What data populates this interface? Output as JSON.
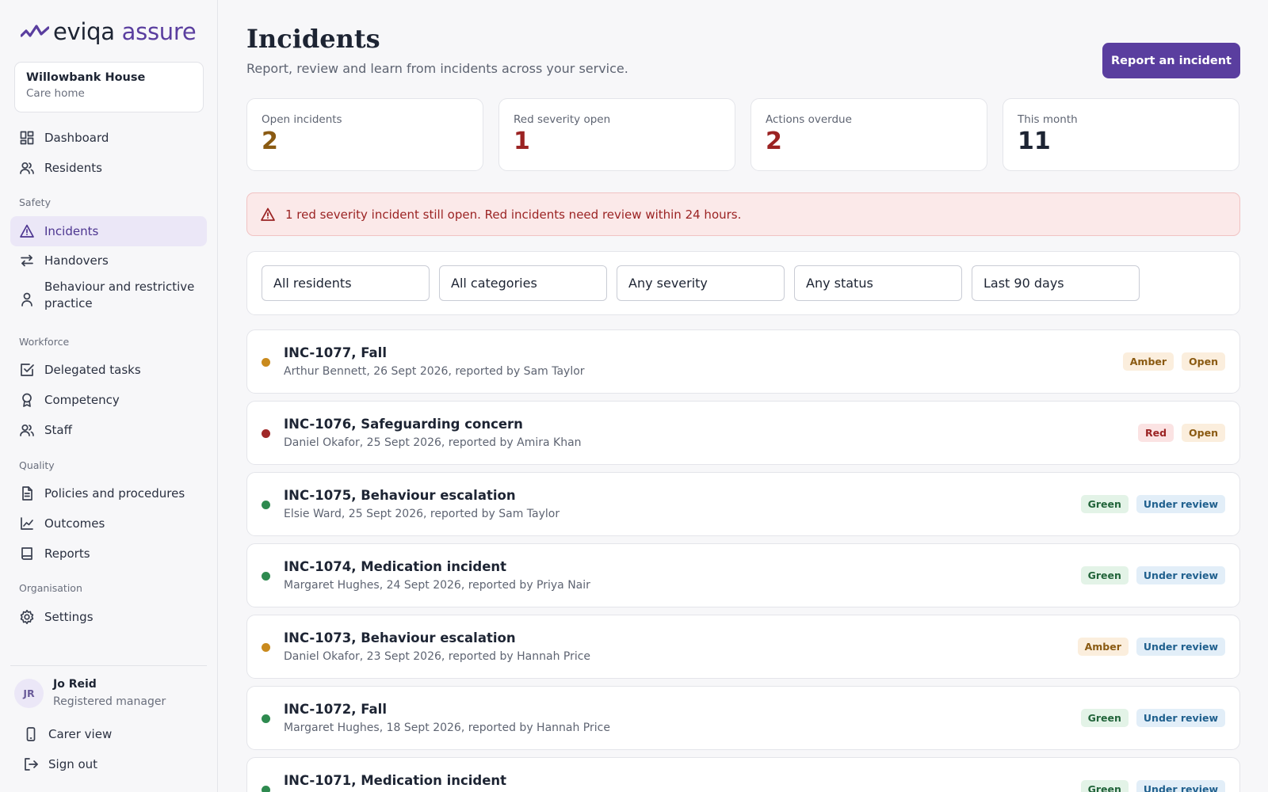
{
  "brand": {
    "name_part1": "eviqa",
    "name_part2": "assure"
  },
  "organisation": {
    "name": "Willowbank House",
    "type": "Care home"
  },
  "nav": {
    "dashboard": "Dashboard",
    "residents": "Residents",
    "section_safety": "Safety",
    "incidents": "Incidents",
    "handovers": "Handovers",
    "behaviour": "Behaviour and restrictive practice",
    "section_workforce": "Workforce",
    "delegated_tasks": "Delegated tasks",
    "competency": "Competency",
    "staff": "Staff",
    "section_quality": "Quality",
    "policies": "Policies and procedures",
    "outcomes": "Outcomes",
    "reports": "Reports",
    "section_organisation": "Organisation",
    "settings": "Settings"
  },
  "user": {
    "initials": "JR",
    "name": "Jo Reid",
    "role": "Registered manager",
    "carer_view": "Carer view",
    "sign_out": "Sign out"
  },
  "page": {
    "title": "Incidents",
    "subtitle": "Report, review and learn from incidents across your service.",
    "report_button": "Report an incident"
  },
  "stats": [
    {
      "label": "Open incidents",
      "value": "2",
      "color": "#8a5a12"
    },
    {
      "label": "Red severity open",
      "value": "1",
      "color": "#9b2323"
    },
    {
      "label": "Actions overdue",
      "value": "2",
      "color": "#9b2323"
    },
    {
      "label": "This month",
      "value": "11",
      "color": "#1d2433"
    }
  ],
  "alert": {
    "text": "1 red severity incident still open. Red incidents need review within 24 hours."
  },
  "filters": [
    "All residents",
    "All categories",
    "Any severity",
    "Any status",
    "Last 90 days"
  ],
  "colors": {
    "accent": "#5a3e9f",
    "amber": "#c98a1d",
    "red": "#a02828",
    "green": "#2e8a4f"
  },
  "incidents": [
    {
      "title": "INC-1077, Fall",
      "meta": "Arthur Bennett, 26 Sept 2026, reported by Sam Taylor",
      "severity": "Amber",
      "status": "Open"
    },
    {
      "title": "INC-1076, Safeguarding concern",
      "meta": "Daniel Okafor, 25 Sept 2026, reported by Amira Khan",
      "severity": "Red",
      "status": "Open"
    },
    {
      "title": "INC-1075, Behaviour escalation",
      "meta": "Elsie Ward, 25 Sept 2026, reported by Sam Taylor",
      "severity": "Green",
      "status": "Under review"
    },
    {
      "title": "INC-1074, Medication incident",
      "meta": "Margaret Hughes, 24 Sept 2026, reported by Priya Nair",
      "severity": "Green",
      "status": "Under review"
    },
    {
      "title": "INC-1073, Behaviour escalation",
      "meta": "Daniel Okafor, 23 Sept 2026, reported by Hannah Price",
      "severity": "Amber",
      "status": "Under review"
    },
    {
      "title": "INC-1072, Fall",
      "meta": "Margaret Hughes, 18 Sept 2026, reported by Hannah Price",
      "severity": "Green",
      "status": "Under review"
    },
    {
      "title": "INC-1071, Medication incident",
      "meta": "",
      "severity": "Green",
      "status": "Under review"
    }
  ]
}
